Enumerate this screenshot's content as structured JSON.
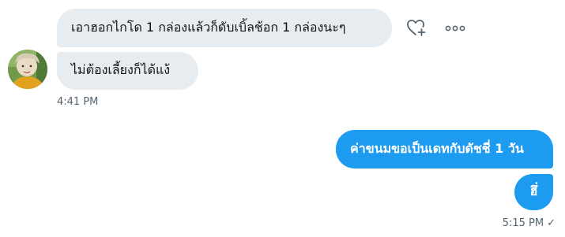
{
  "conversation": {
    "incoming": [
      {
        "text": "เอาฮอกไกโด 1 กล่องแล้วก็ดับเบิ้ลช้อก 1 กล่องนะๆ"
      },
      {
        "text": "ไม่ต้องเลี้ยงก็ได้แง้"
      }
    ],
    "incoming_time": "4:41 PM",
    "outgoing": [
      {
        "text": "ค่าขนมขอเป็นเดทกับดัชชี่ 1 วัน"
      },
      {
        "text": "ฮึ่"
      }
    ],
    "outgoing_time": "5:15 PM",
    "read_mark": "✓"
  },
  "icons": {
    "reaction": "heart-plus-icon",
    "more": "more-horizontal-icon",
    "sent_status": "checkmark-icon"
  },
  "colors": {
    "incoming_bubble": "#e7ecf0",
    "outgoing_bubble": "#1d9bf0",
    "timestamp": "#536471",
    "text": "#0f1419"
  }
}
